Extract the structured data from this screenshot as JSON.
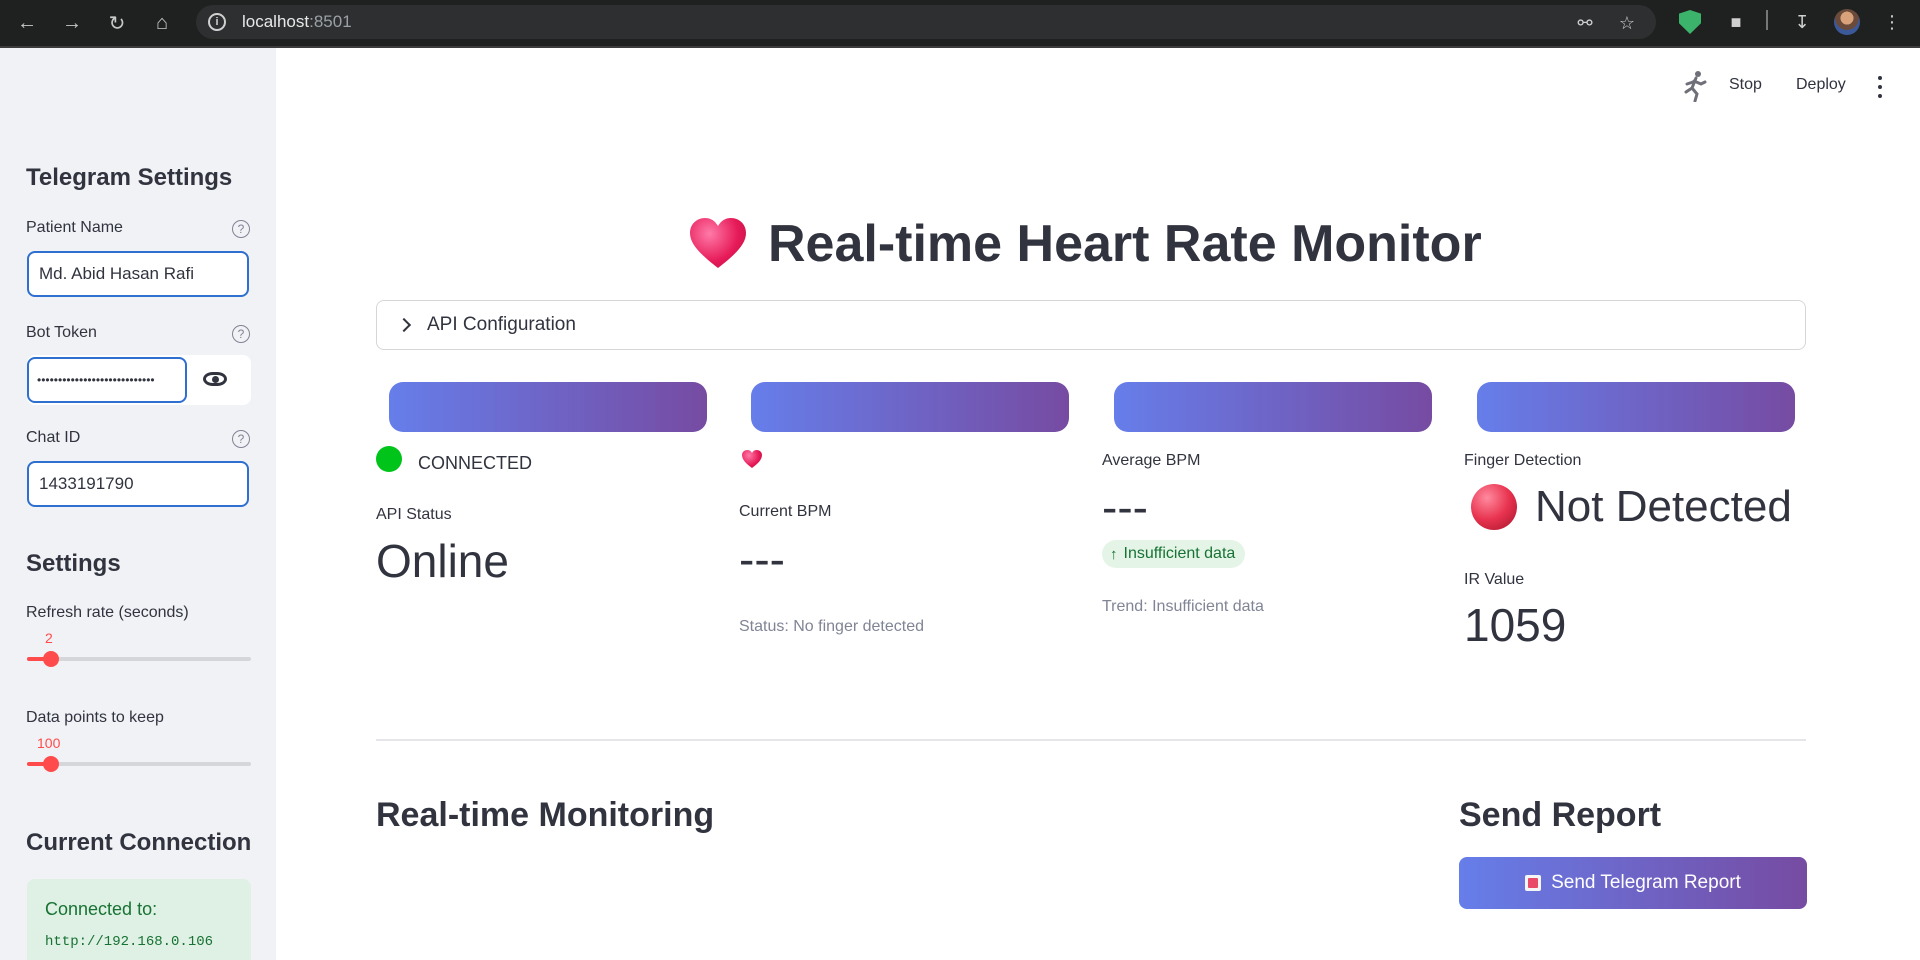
{
  "browser": {
    "url_host": "localhost",
    "url_port": ":8501"
  },
  "sidebar": {
    "telegram_heading": "Telegram Settings",
    "patient_name_label": "Patient Name",
    "patient_name_value": "Md. Abid Hasan Rafi",
    "bot_token_label": "Bot Token",
    "bot_token_masked": "••••••••••••••••••••••••••••",
    "chat_id_label": "Chat ID",
    "chat_id_value": "1433191790",
    "settings_heading": "Settings",
    "refresh_label": "Refresh rate (seconds)",
    "refresh_value": "2",
    "datapoints_label": "Data points to keep",
    "datapoints_value": "100",
    "connection_heading": "Current Connection",
    "connected_to_label": "Connected to:",
    "connected_url": "http://192.168.0.106"
  },
  "toolbar": {
    "stop_label": "Stop",
    "deploy_label": "Deploy"
  },
  "main": {
    "title": "Real-time Heart Rate Monitor",
    "expander_label": "API Configuration",
    "col1": {
      "status_text": "CONNECTED",
      "metric_label": "API Status",
      "metric_value": "Online"
    },
    "col2": {
      "metric_label": "Current BPM",
      "metric_value": "---",
      "caption": "Status: No finger detected"
    },
    "col3": {
      "metric_label": "Average BPM",
      "metric_value": "---",
      "delta": "Insufficient data",
      "caption": "Trend: Insufficient data"
    },
    "col4": {
      "heading": "Finger Detection",
      "detection_text": "Not Detected",
      "metric_label": "IR Value",
      "metric_value": "1059"
    },
    "monitoring_heading": "Real-time Monitoring",
    "report_heading": "Send Report",
    "report_button": "Send Telegram Report"
  },
  "colors": {
    "accent_gradient_start": "#667eea",
    "accent_gradient_end": "#764ba2",
    "slider": "#ff4b4b",
    "connected_dot": "#00c41a",
    "sidebar_bg": "#f0f2f6"
  }
}
